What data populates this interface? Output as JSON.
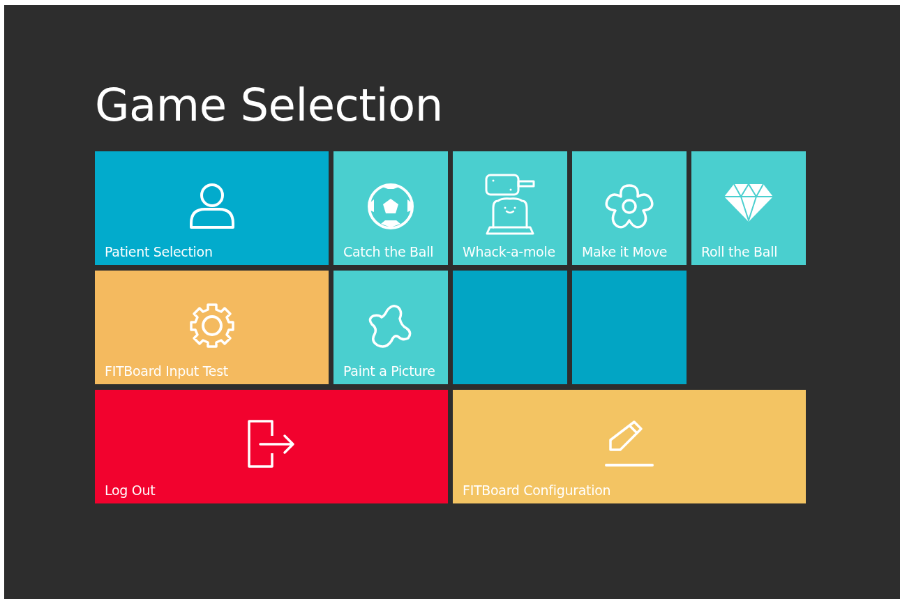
{
  "title": "Game Selection",
  "rows": [
    [
      {
        "kind": "patient",
        "label": "Patient Selection",
        "color": "#02abcc"
      },
      {
        "kind": "ball",
        "label": "Catch the Ball",
        "color": "#4acfcf"
      },
      {
        "kind": "mole",
        "label": "Whack-a-mole",
        "color": "#4acfcf"
      },
      {
        "kind": "flower",
        "label": "Make it Move",
        "color": "#4acfcf"
      },
      {
        "kind": "diamond",
        "label": "Roll the Ball",
        "color": "#4acfcf"
      }
    ],
    [
      {
        "kind": "test",
        "label": "FITBoard Input Test",
        "color": "#f4ba5f"
      },
      {
        "kind": "paint",
        "label": "Paint a Picture",
        "color": "#4acfcf"
      },
      {
        "kind": "blank",
        "color": "#02a5c4"
      },
      {
        "kind": "blank",
        "color": "#02a5c4"
      }
    ],
    [
      {
        "kind": "logout",
        "label": "Log Out",
        "color": "#f2022e"
      },
      {
        "kind": "config",
        "label": "FITBoard Configuration",
        "color": "#f3c463"
      }
    ]
  ]
}
